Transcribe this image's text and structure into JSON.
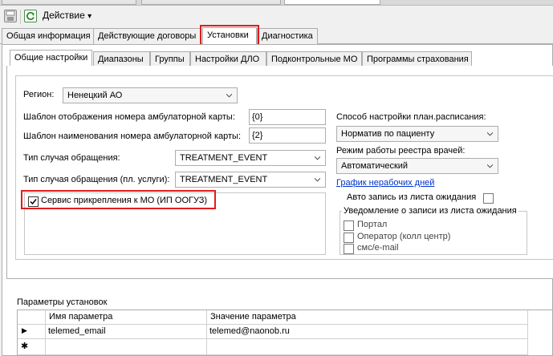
{
  "toolbar": {
    "action_label": "Действие",
    "action_arrow": "▾"
  },
  "main_tabs": [
    {
      "label": "Общая информация",
      "selected": false
    },
    {
      "label": "Действующие договоры",
      "selected": false
    },
    {
      "label": "Установки",
      "selected": true
    },
    {
      "label": "Диагностика",
      "selected": false
    }
  ],
  "sub_tabs": [
    {
      "label": "Общие настройки",
      "selected": true
    },
    {
      "label": "Диапазоны",
      "selected": false
    },
    {
      "label": "Группы",
      "selected": false
    },
    {
      "label": "Настройки ДЛО",
      "selected": false
    },
    {
      "label": "Подконтрольные МО",
      "selected": false
    },
    {
      "label": "Программы страхования",
      "selected": false
    }
  ],
  "settings": {
    "region_label": "Регион:",
    "region_value": "Ненецкий АО",
    "outpatient_display_label": "Шаблон отображения номера амбулаторной карты:",
    "outpatient_display_value": "{0}",
    "outpatient_name_label": "Шаблон наименования номера амбулаторной карты:",
    "outpatient_name_value": "{2}",
    "case_type_label": "Тип случая обращения:",
    "case_type_value": "TREATMENT_EVENT",
    "case_type_paid_label": "Тип случая обращения (пл. услуги):",
    "case_type_paid_value": "TREATMENT_EVENT",
    "attach_service_label": "Сервис прикрепления к МО (ИП ООГУЗ)",
    "attach_service_checked": true,
    "schedule_method_label": "Способ настройки план.расписания:",
    "schedule_method_value": "Норматив по пациенту",
    "registry_mode_label": "Режим работы реестра врачей:",
    "registry_mode_value": "Автоматический",
    "non_working_days_link": "График нерабочих дней",
    "auto_waitlist_label": "Авто запись из листа ожидания",
    "auto_waitlist_checked": false,
    "notification_group_title": "Уведомление о записи из листа ожидания",
    "notification_options": [
      {
        "label": "Портал",
        "checked": false
      },
      {
        "label": "Оператор (колл центр)",
        "checked": false
      },
      {
        "label": "смс/e-mail",
        "checked": false
      }
    ]
  },
  "params": {
    "title": "Параметры установок",
    "columns": [
      "Имя параметра",
      "Значение параметра"
    ],
    "rows": [
      {
        "name": "telemed_email",
        "value": "telemed@naonob.ru"
      }
    ],
    "new_row_marker": "✱",
    "current_row_marker": "▶"
  },
  "colors": {
    "highlight": "#e31b1b",
    "link": "#0033cc",
    "icon_green": "#2e8b2e"
  }
}
